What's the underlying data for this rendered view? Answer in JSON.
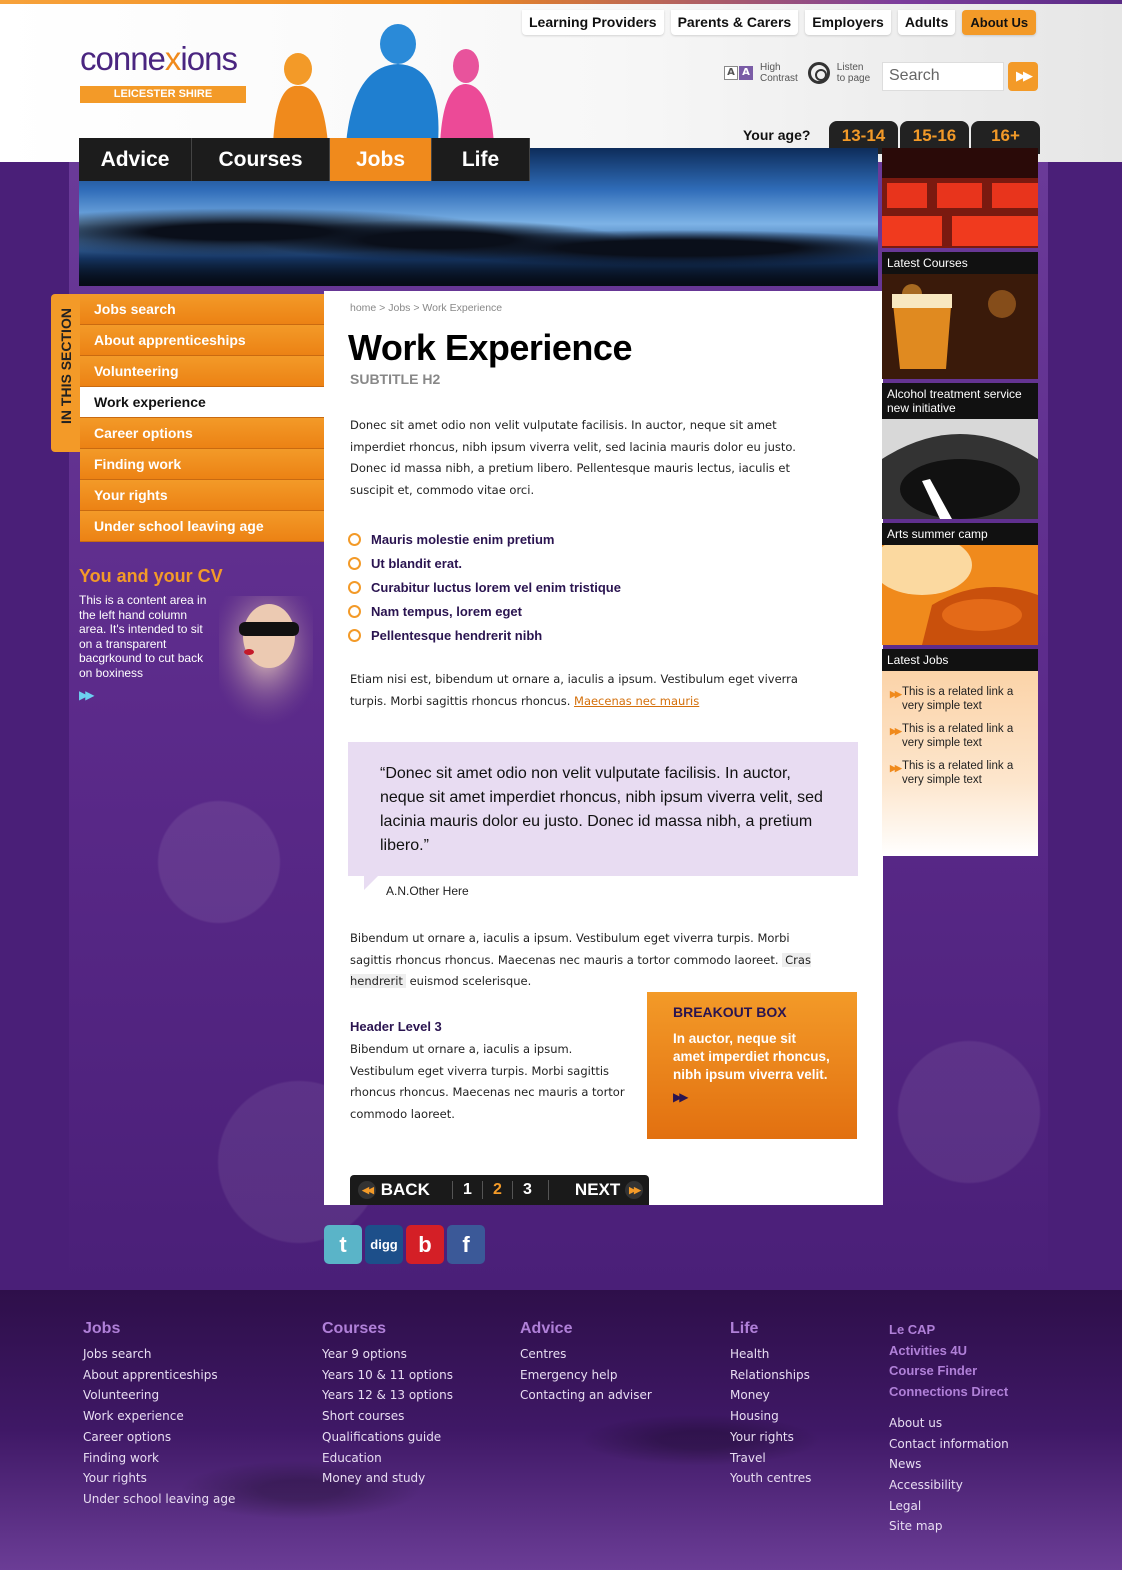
{
  "brand": {
    "name_part1": "conne",
    "name_x": "x",
    "name_part2": "ions",
    "region": "LEICESTER SHIRE"
  },
  "top_links": [
    "Learning Providers",
    "Parents & Carers",
    "Employers",
    "Adults",
    "About Us"
  ],
  "tools": {
    "contrast_label_1": "High",
    "contrast_label_2": "Contrast",
    "listen_label_1": "Listen",
    "listen_label_2": "to page",
    "aa_small": "A",
    "aa_large": "A"
  },
  "search": {
    "placeholder": "Search",
    "go_icon": "double-arrow-right"
  },
  "age": {
    "label": "Your age?",
    "tabs": [
      "13-14",
      "15-16",
      "16+"
    ]
  },
  "main_nav": [
    {
      "label": "Advice",
      "active": false
    },
    {
      "label": "Courses",
      "active": false
    },
    {
      "label": "Jobs",
      "active": true
    },
    {
      "label": "Life",
      "active": false
    }
  ],
  "section_tab": "IN THIS SECTION",
  "left_nav": [
    {
      "label": "Jobs search",
      "active": false
    },
    {
      "label": "About apprenticeships",
      "active": false
    },
    {
      "label": "Volunteering",
      "active": false
    },
    {
      "label": "Work experience",
      "active": true
    },
    {
      "label": "Career options",
      "active": false
    },
    {
      "label": "Finding work",
      "active": false
    },
    {
      "label": "Your rights",
      "active": false
    },
    {
      "label": "Under school leaving age",
      "active": false
    }
  ],
  "cv_box": {
    "title": "You and your CV",
    "text": "This is a content area in the left hand column area.  It's intended to sit on a transparent bacgrkound to cut back on boxiness"
  },
  "main": {
    "breadcrumb": "home > Jobs > Work Experience",
    "title": "Work Experience",
    "subtitle": "SUBTITLE H2",
    "para1": "Donec sit amet odio non velit vulputate facilisis. In auctor, neque sit amet imperdiet rhoncus, nibh ipsum viverra velit, sed lacinia mauris dolor eu justo. Donec id massa nibh, a pretium libero. Pellentesque mauris lectus, iaculis et suscipit et, commodo vitae orci.",
    "bullets": [
      "Mauris molestie enim pretium",
      "Ut blandit erat.",
      "Curabitur luctus lorem vel enim tristique",
      "Nam tempus, lorem eget",
      "Pellentesque hendrerit nibh"
    ],
    "para2_text": "Etiam nisi est, bibendum ut ornare a, iaculis a ipsum. Vestibulum eget viverra turpis. Morbi sagittis rhoncus rhoncus.",
    "para2_link": "Maecenas nec mauris",
    "quote": "“Donec sit amet odio non velit vulputate facilisis. In auctor, neque sit amet imperdiet rhoncus, nibh ipsum viverra velit, sed lacinia mauris dolor eu justo. Donec id massa nibh, a pretium libero.”",
    "quote_author": "A.N.Other Here",
    "para3_text": "Bibendum ut ornare a, iaculis a ipsum. Vestibulum eget viverra turpis. Morbi sagittis rhoncus rhoncus. Maecenas nec mauris a tortor commodo laoreet.",
    "para3_highlight": "Cras hendrerit",
    "para3_tail": "euismod scelerisque.",
    "h3": "Header Level 3",
    "para4": "Bibendum ut ornare a, iaculis a ipsum. Vestibulum eget viverra turpis. Morbi sagittis rhoncus rhoncus. Maecenas nec mauris a tortor commodo laoreet.",
    "breakout": {
      "title": "BREAKOUT BOX",
      "text": "In auctor, neque sit amet imperdiet rhoncus, nibh ipsum viverra velit."
    },
    "pager": {
      "back": "BACK",
      "next": "NEXT",
      "pages": [
        "1",
        "2",
        "3"
      ],
      "current": "2"
    }
  },
  "right_promos": [
    {
      "caption": "Latest Courses"
    },
    {
      "caption": "Alcohol treatment service new initiative"
    },
    {
      "caption": "Arts summer camp"
    },
    {
      "caption": "Latest Jobs"
    }
  ],
  "related_links": [
    "This is a related link a very simple text",
    "This is a related link a very simple text",
    "This is a related link a very simple text"
  ],
  "social": [
    {
      "name": "twitter",
      "label": "t",
      "color": "#5ab4c8"
    },
    {
      "name": "digg",
      "label": "digg",
      "color": "#1d4f8a"
    },
    {
      "name": "bebo",
      "label": "b",
      "color": "#d41f26"
    },
    {
      "name": "facebook",
      "label": "f",
      "color": "#3b5998"
    }
  ],
  "footer": {
    "jobs": {
      "title": "Jobs",
      "links": [
        "Jobs search",
        "About apprenticeships",
        "Volunteering",
        "Work experience",
        "Career options",
        "Finding work",
        "Your rights",
        "Under school leaving age"
      ]
    },
    "courses": {
      "title": "Courses",
      "links": [
        "Year 9 options",
        "Years 10 & 11 options",
        "Years 12 & 13 options",
        "Short courses",
        "Qualifications guide",
        "Education",
        "Money and study"
      ]
    },
    "advice": {
      "title": "Advice",
      "links": [
        "Centres",
        "Emergency help",
        "Contacting an adviser"
      ]
    },
    "life": {
      "title": "Life",
      "links": [
        "Health",
        "Relationships",
        "Money",
        "Housing",
        "Your rights",
        "Travel",
        "Youth centres"
      ]
    },
    "featured": [
      "Le CAP",
      "Activities 4U",
      "Course Finder",
      "Connections Direct"
    ],
    "misc": [
      "About us",
      "Contact information",
      "News",
      "Accessibility",
      "Legal",
      "Site map"
    ]
  },
  "colors": {
    "brand_orange": "#f39a28",
    "brand_purple": "#4a2580",
    "bg_purple": "#4a1f78"
  }
}
